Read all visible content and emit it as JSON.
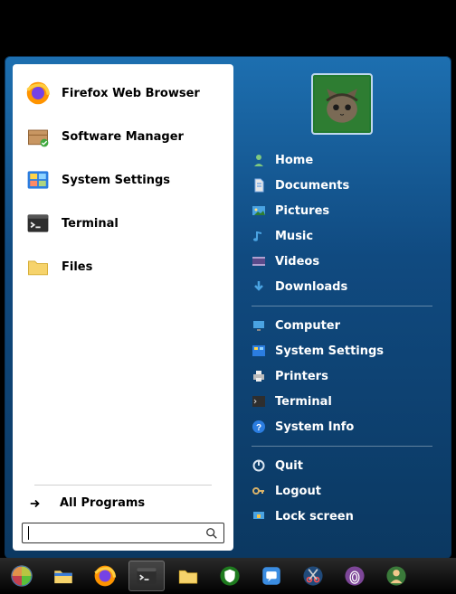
{
  "start_menu": {
    "apps": [
      {
        "id": "firefox",
        "label": "Firefox Web Browser",
        "icon": "firefox-icon"
      },
      {
        "id": "software",
        "label": "Software Manager",
        "icon": "package-icon"
      },
      {
        "id": "settings",
        "label": "System Settings",
        "icon": "settings-panel-icon"
      },
      {
        "id": "terminal",
        "label": "Terminal",
        "icon": "terminal-icon"
      },
      {
        "id": "files",
        "label": "Files",
        "icon": "folder-icon"
      }
    ],
    "all_programs_label": "All Programs",
    "search": {
      "value": "",
      "placeholder": ""
    }
  },
  "places": {
    "group1": [
      {
        "id": "home",
        "label": "Home",
        "icon": "home-user-icon"
      },
      {
        "id": "documents",
        "label": "Documents",
        "icon": "document-icon"
      },
      {
        "id": "pictures",
        "label": "Pictures",
        "icon": "pictures-icon"
      },
      {
        "id": "music",
        "label": "Music",
        "icon": "music-note-icon"
      },
      {
        "id": "videos",
        "label": "Videos",
        "icon": "videos-icon"
      },
      {
        "id": "downloads",
        "label": "Downloads",
        "icon": "download-arrow-icon"
      }
    ],
    "group2": [
      {
        "id": "computer",
        "label": "Computer",
        "icon": "computer-icon"
      },
      {
        "id": "system-settings",
        "label": "System Settings",
        "icon": "settings-panel-icon"
      },
      {
        "id": "printers",
        "label": "Printers",
        "icon": "printer-icon"
      },
      {
        "id": "terminal2",
        "label": "Terminal",
        "icon": "terminal-icon"
      },
      {
        "id": "system-info",
        "label": "System Info",
        "icon": "info-icon"
      }
    ],
    "group3": [
      {
        "id": "quit",
        "label": "Quit",
        "icon": "power-icon"
      },
      {
        "id": "logout",
        "label": "Logout",
        "icon": "key-icon"
      },
      {
        "id": "lock",
        "label": "Lock screen",
        "icon": "lock-monitor-icon"
      }
    ]
  },
  "taskbar": {
    "items": [
      {
        "id": "start",
        "icon": "start-orb-icon",
        "active": false
      },
      {
        "id": "files",
        "icon": "file-manager-icon",
        "active": false
      },
      {
        "id": "firefox",
        "icon": "firefox-icon",
        "active": false
      },
      {
        "id": "terminal",
        "icon": "terminal-icon",
        "active": true
      },
      {
        "id": "explorer",
        "icon": "folder-icon",
        "active": false
      },
      {
        "id": "shield",
        "icon": "shield-circle-icon",
        "active": false
      },
      {
        "id": "chat",
        "icon": "chat-bubble-icon",
        "active": false
      },
      {
        "id": "snip",
        "icon": "scissors-icon",
        "active": false
      },
      {
        "id": "tor",
        "icon": "onion-icon",
        "active": false
      },
      {
        "id": "user",
        "icon": "user-avatar-icon",
        "active": false
      }
    ]
  },
  "colors": {
    "accent_blue": "#1d6fb0",
    "deep_blue": "#0b3861",
    "white": "#ffffff"
  }
}
